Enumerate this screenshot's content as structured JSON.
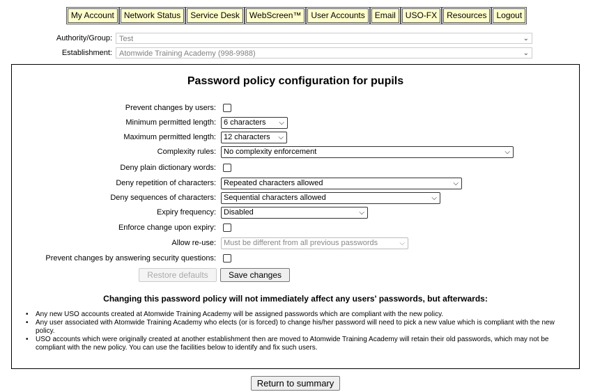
{
  "nav": {
    "items": [
      "My Account",
      "Network Status",
      "Service Desk",
      "WebScreen™",
      "User Accounts",
      "Email",
      "USO-FX",
      "Resources",
      "Logout"
    ]
  },
  "authority": {
    "label": "Authority/Group:",
    "value": "Test"
  },
  "establishment": {
    "label": "Establishment:",
    "value": "Atomwide Training Academy (998-9988)"
  },
  "form": {
    "title": "Password policy configuration for pupils",
    "prevent_changes_label": "Prevent changes by users:",
    "min_length_label": "Minimum permitted length:",
    "min_length_value": "6 characters",
    "max_length_label": "Maximum permitted length:",
    "max_length_value": "12 characters",
    "complexity_label": "Complexity rules:",
    "complexity_value": "No complexity enforcement",
    "deny_dictionary_label": "Deny plain dictionary words:",
    "deny_repetition_label": "Deny repetition of characters:",
    "deny_repetition_value": "Repeated characters allowed",
    "deny_sequences_label": "Deny sequences of characters:",
    "deny_sequences_value": "Sequential characters allowed",
    "expiry_label": "Expiry frequency:",
    "expiry_value": "Disabled",
    "enforce_change_label": "Enforce change upon expiry:",
    "reuse_label": "Allow re-use:",
    "reuse_value": "Must be different from all previous passwords",
    "security_questions_label": "Prevent changes by answering security questions:",
    "restore_label": "Restore defaults",
    "save_label": "Save changes"
  },
  "note": {
    "heading": "Changing this password policy will not immediately affect any users' passwords, but afterwards:",
    "bullets": [
      "Any new USO accounts created at Atomwide Training Academy will be assigned passwords which are compliant with the new policy.",
      "Any user associated with Atomwide Training Academy who elects (or is forced) to change his/her password will need to pick a new value which is compliant with the new policy.",
      "USO accounts which were originally created at another establishment then are moved to Atomwide Training Academy will retain their old passwords, which may not be compliant with the new policy. You can use the facilities below to identify and fix such users."
    ]
  },
  "return_label": "Return to summary"
}
